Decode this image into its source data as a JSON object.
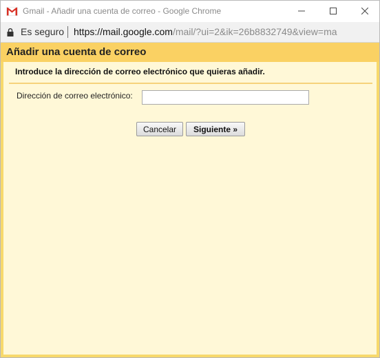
{
  "window": {
    "title": "Gmail - Añadir una cuenta de correo - Google Chrome",
    "icons": {
      "app": "gmail-icon",
      "minimize": "minimize-icon",
      "maximize": "maximize-icon",
      "close": "close-icon"
    }
  },
  "addressbar": {
    "security_label": "Es seguro",
    "url_host": "https://mail.google.com",
    "url_path": "/mail/?ui=2&ik=26b8832749&view=ma",
    "icons": {
      "lock": "lock-icon"
    }
  },
  "dialog": {
    "title": "Añadir una cuenta de correo",
    "instruction": "Introduce la dirección de correo electrónico que quieras añadir.",
    "email_label": "Dirección de correo electrónico:",
    "email_value": "",
    "cancel_label": "Cancelar",
    "next_label": "Siguiente »"
  },
  "colors": {
    "header": "#fad163",
    "body": "#fff8d7",
    "gmail_red": "#d93025"
  }
}
